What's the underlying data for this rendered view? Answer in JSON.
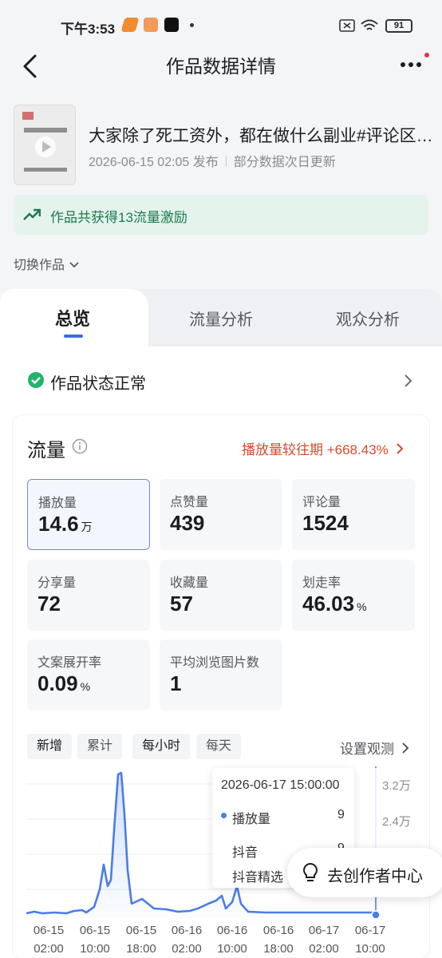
{
  "status_bar": {
    "time": "下午3:53",
    "battery": "91"
  },
  "header": {
    "title": "作品数据详情"
  },
  "work": {
    "title": "大家除了死工资外，都在做什么副业#评论区…",
    "date": "2026-06-15 02:05 发布",
    "update_note": "部分数据次日更新"
  },
  "incentive": {
    "text": "作品共获得13流量激励"
  },
  "switch_label": "切换作品",
  "tabs": [
    {
      "label": "总览"
    },
    {
      "label": "流量分析"
    },
    {
      "label": "观众分析"
    }
  ],
  "work_status": "作品状态正常",
  "flow": {
    "title": "流量",
    "compare": "播放量较往期 +668.43%",
    "metrics": [
      {
        "label": "播放量",
        "value": "14.6",
        "unit": "万"
      },
      {
        "label": "点赞量",
        "value": "439",
        "unit": ""
      },
      {
        "label": "评论量",
        "value": "1524",
        "unit": ""
      },
      {
        "label": "分享量",
        "value": "72",
        "unit": ""
      },
      {
        "label": "收藏量",
        "value": "57",
        "unit": ""
      },
      {
        "label": "划走率",
        "value": "46.03",
        "unit": "%"
      },
      {
        "label": "文案展开率",
        "value": "0.09",
        "unit": "%"
      },
      {
        "label": "平均浏览图片数",
        "value": "1",
        "unit": ""
      }
    ],
    "chips": [
      "新增",
      "累计",
      "每小时",
      "每天"
    ],
    "set_watch": "设置观测"
  },
  "chart_data": {
    "type": "line",
    "x_ticks": [
      "06-15\n02:00",
      "06-15\n10:00",
      "06-15\n18:00",
      "06-16\n02:00",
      "06-16\n10:00",
      "06-16\n18:00",
      "06-17\n02:00",
      "06-17\n10:00"
    ],
    "y_ticks": [
      "3.2万",
      "2.4万"
    ],
    "tooltip": {
      "time": "2026-06-17 15:00:00",
      "rows": [
        {
          "name": "播放量",
          "value": "9"
        },
        {
          "name": "抖音",
          "value": "9"
        },
        {
          "name": "抖音精选",
          "value": ""
        }
      ]
    },
    "series_color": "#4a7de6"
  },
  "creator_center": "去创作者中心"
}
